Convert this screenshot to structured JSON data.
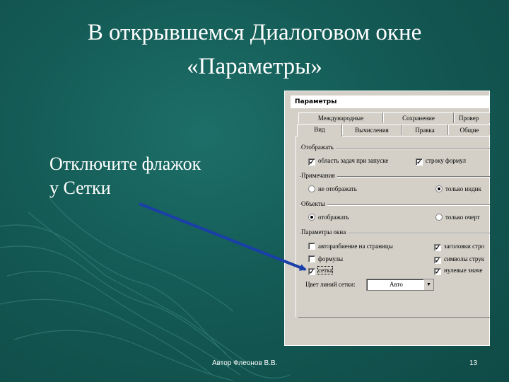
{
  "slide": {
    "title_line1": "В открывшемся Диалоговом окне",
    "title_line2": "«Параметры»",
    "instruction_line1": "Отключите флажок",
    "instruction_line2": "у  Сетки",
    "footer_author": "Автор Флеонов В.В.",
    "page_number": "13",
    "arrow_color": "#1a3fa8",
    "text_color": "#ffffff"
  },
  "dialog": {
    "title": "Параметры",
    "tabs_row1": [
      "Международные",
      "Сохранение",
      "Провер"
    ],
    "tabs_row2": [
      "Вид",
      "Вычисления",
      "Правка",
      "Общие"
    ],
    "groups": {
      "show": {
        "label": "Отображать",
        "opt1": {
          "label": "область задач при запуске",
          "checked": true
        },
        "opt2": {
          "label": "строку формул",
          "checked": true
        }
      },
      "notes": {
        "label": "Примечания",
        "opt1": {
          "label": "не отображать",
          "selected": false
        },
        "opt2": {
          "label": "только индик",
          "selected": true
        }
      },
      "objects": {
        "label": "Объекты",
        "opt1": {
          "label": "отображать",
          "selected": true
        },
        "opt2": {
          "label": "только очерт",
          "selected": false
        }
      },
      "window": {
        "label": "Параметры окна",
        "left": [
          {
            "label": "авторазбиение на страницы",
            "checked": false
          },
          {
            "label": "формулы",
            "checked": false
          },
          {
            "label": "сетка",
            "checked": true
          }
        ],
        "right": [
          {
            "label": "заголовки стро",
            "checked": true
          },
          {
            "label": "символы струк",
            "checked": true
          },
          {
            "label": "нулевые значе",
            "checked": true
          }
        ]
      }
    },
    "gridline_color_label": "Цвет линий сетки:",
    "gridline_color_value": "Авто",
    "check_mark": "✓",
    "dropdown_arrow": "▼"
  }
}
